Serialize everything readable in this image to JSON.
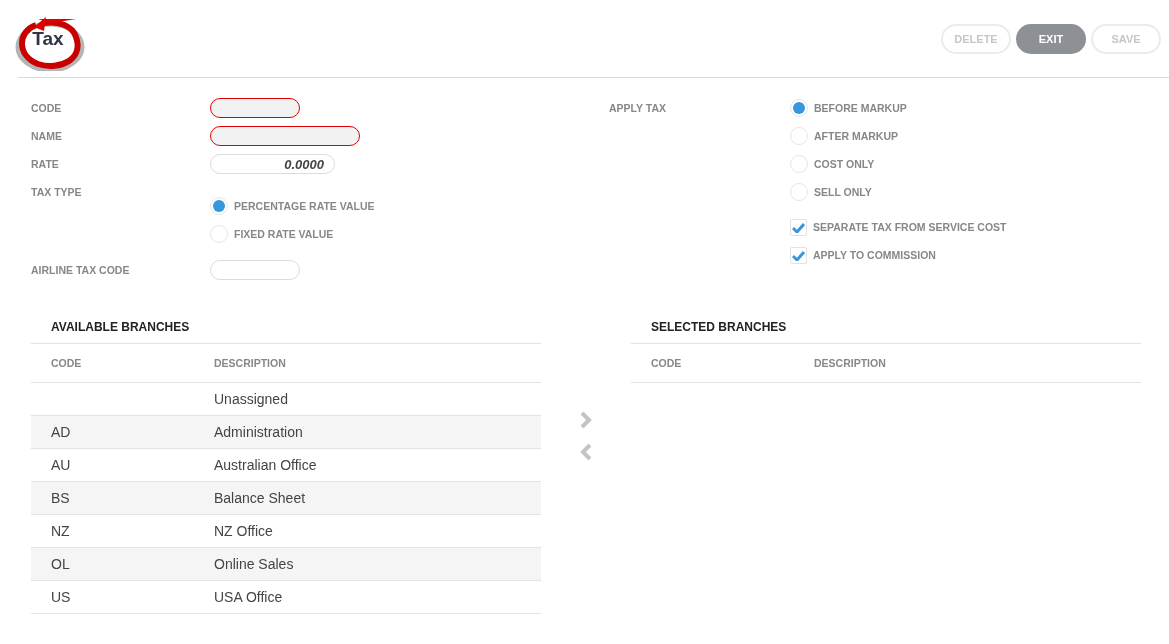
{
  "title": "Tax",
  "actions": [
    {
      "label": "DELETE",
      "disabled": true
    },
    {
      "label": "EXIT",
      "disabled": false
    },
    {
      "label": "SAVE",
      "disabled": true
    }
  ],
  "fields": [
    {
      "label": "CODE",
      "invalid": true
    },
    {
      "label": "NAME",
      "invalid": true
    },
    {
      "label": "RATE",
      "value": "0.0000",
      "invalid": false
    }
  ],
  "tax_type": {
    "label": "TAX TYPE",
    "options": [
      {
        "label": "PERCENTAGE RATE VALUE",
        "selected": true
      },
      {
        "label": "FIXED RATE VALUE",
        "selected": false
      }
    ]
  },
  "airline_tax_code": {
    "label": "AIRLINE TAX CODE"
  },
  "apply_tax": {
    "label": "APPLY TAX",
    "options": [
      {
        "label": "BEFORE MARKUP",
        "selected": true
      },
      {
        "label": "AFTER MARKUP",
        "selected": false
      },
      {
        "label": "COST ONLY",
        "selected": false
      },
      {
        "label": "SELL ONLY",
        "selected": false
      }
    ]
  },
  "checkboxes": [
    {
      "label": "SEPARATE TAX FROM SERVICE COST",
      "checked": true
    },
    {
      "label": "APPLY TO COMMISSION",
      "checked": true
    }
  ],
  "available_branches": {
    "title": "AVAILABLE BRANCHES",
    "columns": [
      "CODE",
      "DESCRIPTION"
    ],
    "rows": [
      {
        "description": "Unassigned"
      },
      {
        "code": "AD",
        "description": "Administration"
      },
      {
        "code": "AU",
        "description": "Australian Office"
      },
      {
        "code": "BS",
        "description": "Balance Sheet"
      },
      {
        "code": "NZ",
        "description": "NZ Office"
      },
      {
        "code": "OL",
        "description": "Online Sales"
      },
      {
        "code": "US",
        "description": "USA Office"
      }
    ]
  },
  "selected_branches": {
    "title": "SELECTED BRANCHES",
    "columns": [
      "CODE",
      "DESCRIPTION"
    ]
  }
}
